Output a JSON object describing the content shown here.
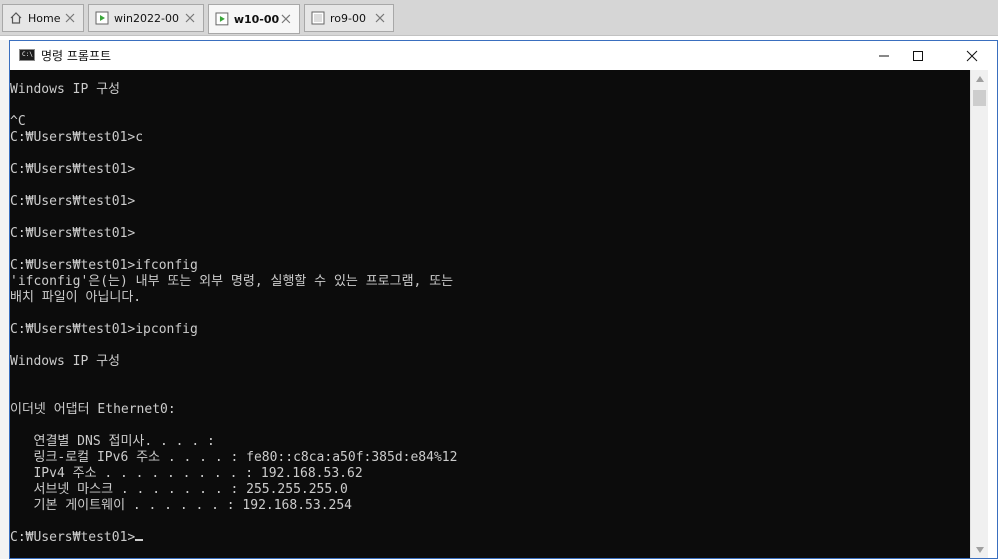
{
  "host_tabs": [
    {
      "label": "Home",
      "icon": "home-icon",
      "active": false
    },
    {
      "label": "win2022-00",
      "icon": "vm-icon",
      "active": false
    },
    {
      "label": "w10-00",
      "icon": "vm-icon",
      "active": true
    },
    {
      "label": "ro9-00",
      "icon": "vm-icon",
      "active": false
    }
  ],
  "window": {
    "title": "명령 프롬프트",
    "icon": "cmd-icon"
  },
  "console": {
    "lines": [
      "Windows IP 구성",
      "",
      "^C",
      "C:₩Users₩test01>c",
      "",
      "C:₩Users₩test01>",
      "",
      "C:₩Users₩test01>",
      "",
      "C:₩Users₩test01>",
      "",
      "C:₩Users₩test01>ifconfig",
      "'ifconfig'은(는) 내부 또는 외부 명령, 실행할 수 있는 프로그램, 또는",
      "배치 파일이 아닙니다.",
      "",
      "C:₩Users₩test01>ipconfig",
      "",
      "Windows IP 구성",
      "",
      "",
      "이더넷 어댑터 Ethernet0:",
      "",
      "   연결별 DNS 접미사. . . . :",
      "   링크-로컬 IPv6 주소 . . . . : fe80::c8ca:a50f:385d:e84%12",
      "   IPv4 주소 . . . . . . . . . : 192.168.53.62",
      "   서브넷 마스크 . . . . . . . : 255.255.255.0",
      "   기본 게이트웨이 . . . . . . : 192.168.53.254",
      ""
    ],
    "prompt": "C:₩Users₩test01>"
  },
  "colors": {
    "console_bg": "#0c0c0c",
    "console_fg": "#cccccc",
    "window_border": "#3a6fbf"
  }
}
